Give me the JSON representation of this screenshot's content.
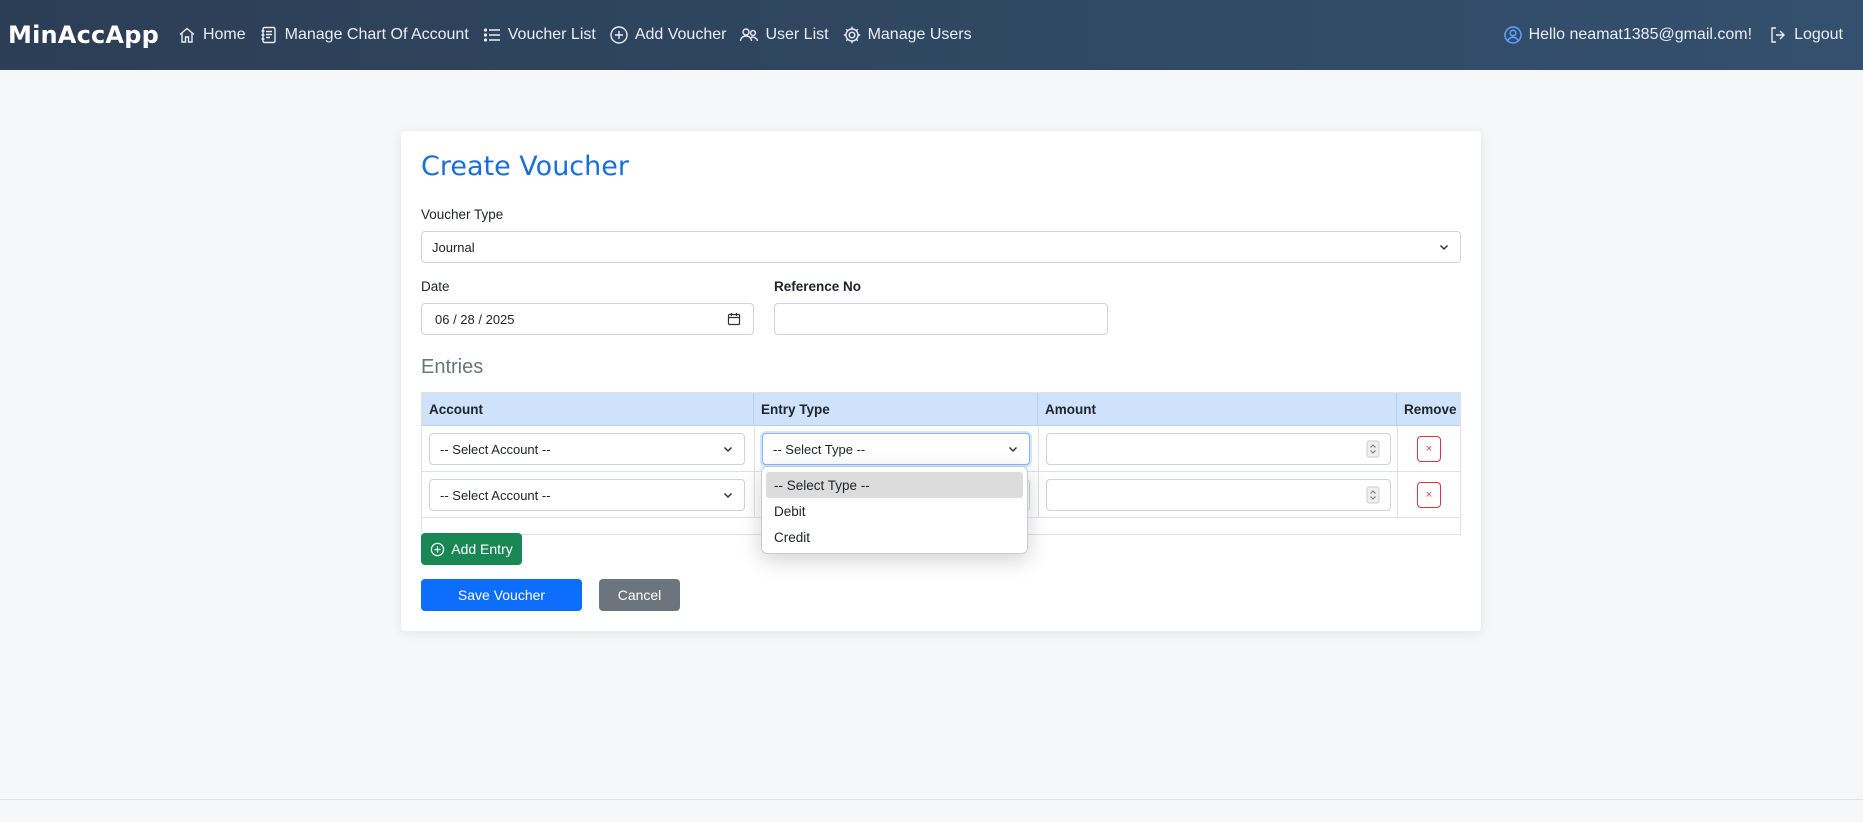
{
  "navbar": {
    "brand": "MinAccApp",
    "links": [
      {
        "label": "Home",
        "icon": "home-icon"
      },
      {
        "label": "Manage Chart Of Account",
        "icon": "journal-icon"
      },
      {
        "label": "Voucher List",
        "icon": "list-icon"
      },
      {
        "label": "Add Voucher",
        "icon": "plus-circle-icon"
      },
      {
        "label": "User List",
        "icon": "people-icon"
      },
      {
        "label": "Manage Users",
        "icon": "gear-icon"
      }
    ],
    "greeting": "Hello neamat1385@gmail.com!",
    "logout": "Logout"
  },
  "form": {
    "title": "Create Voucher",
    "voucher_type_label": "Voucher Type",
    "voucher_type_value": "Journal",
    "date_label": "Date",
    "date_value": "06 / 28 / 2025",
    "reference_label": "Reference No",
    "reference_value": "",
    "entries_title": "Entries"
  },
  "table": {
    "headers": [
      "Account",
      "Entry Type",
      "Amount",
      "Remove"
    ],
    "rows": [
      {
        "account": "-- Select Account --",
        "entry_type": "-- Select Type --",
        "amount": "",
        "remove": "×"
      },
      {
        "account": "-- Select Account --",
        "entry_type": "-- Select Type --",
        "amount": "",
        "remove": "×"
      }
    ]
  },
  "dropdown": {
    "options": [
      "-- Select Type --",
      "Debit",
      "Credit"
    ],
    "selected_index": 0
  },
  "buttons": {
    "add_entry": "Add Entry",
    "save": "Save Voucher",
    "cancel": "Cancel"
  },
  "colors": {
    "navbar": "#2c3e55",
    "title": "#1a6fd6",
    "primary": "#0d6efd",
    "success": "#198754",
    "secondary": "#6c757d",
    "danger": "#dc3545",
    "table_header": "#cfe2fc"
  }
}
